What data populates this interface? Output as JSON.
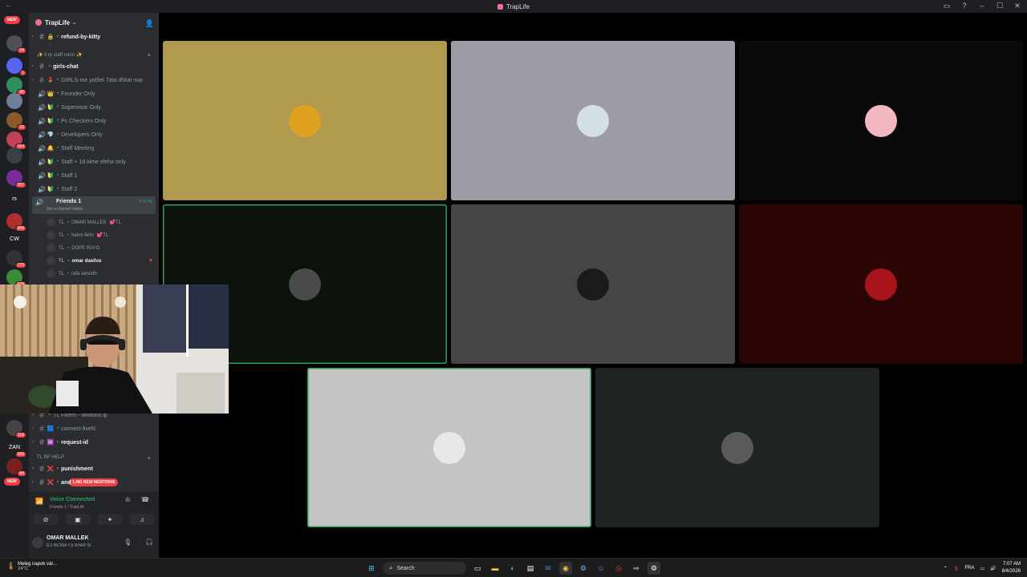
{
  "window": {
    "title": "TrapLife"
  },
  "servers": [
    {
      "label": "NEW",
      "badge": "",
      "color": "#f23f43"
    },
    {
      "label": "",
      "badge": "24",
      "color": "#4e5058"
    },
    {
      "label": "",
      "badge": "1",
      "color": "#5865f2"
    },
    {
      "label": "",
      "badge": "96",
      "color": "#2f8f5b"
    },
    {
      "label": "",
      "badge": "",
      "color": "#6d7f99"
    },
    {
      "label": "",
      "badge": "22",
      "color": "#8a5a2b"
    },
    {
      "label": "",
      "badge": "164",
      "color": "#c2405a"
    },
    {
      "label": "",
      "badge": "",
      "color": "#3b3f45"
    },
    {
      "label": "",
      "badge": "287",
      "color": "#7a2b9a"
    },
    {
      "label": "rs",
      "badge": "",
      "color": "#1e1f22"
    },
    {
      "label": "",
      "badge": "306",
      "color": "#b0302f"
    },
    {
      "label": "CW",
      "badge": "",
      "color": "#1e1f22"
    },
    {
      "label": "",
      "badge": "179",
      "color": "#333"
    },
    {
      "label": "",
      "badge": "678",
      "color": "#3a8a3a"
    }
  ],
  "servers_lower": [
    {
      "label": "",
      "badge": "116",
      "color": "#444"
    },
    {
      "label": "ZAN",
      "badge": "306",
      "color": "#222"
    },
    {
      "label": "",
      "badge": "84",
      "color": "#7a1f1f"
    },
    {
      "label": "NEW",
      "badge": "",
      "color": "#f23f43"
    }
  ],
  "server": {
    "name": "TrapLife"
  },
  "channels_top": [
    {
      "type": "text",
      "emoji": "🔒",
      "name": "refund-by-kitty",
      "bold": true
    }
  ],
  "category_staff": "✨ tl rp staff room ✨",
  "channels_staff": [
    {
      "type": "text",
      "emoji": "",
      "name": "girls-chat",
      "bold": true
    },
    {
      "type": "text",
      "emoji": "💄",
      "name": "GIRLS-me yot5el 7ata dhkar-svp",
      "bold": false
    },
    {
      "type": "voice",
      "emoji": "👑",
      "name": "Founder Only",
      "bold": false
    },
    {
      "type": "voice",
      "emoji": "🔰",
      "name": "Supervisor Only",
      "bold": false
    },
    {
      "type": "voice",
      "emoji": "🔰",
      "name": "Pc Checkers Only",
      "bold": false
    },
    {
      "type": "voice",
      "emoji": "💎",
      "name": "Developers Only",
      "bold": false
    },
    {
      "type": "voice",
      "emoji": "🔔",
      "name": "Staff Meeting",
      "bold": false
    },
    {
      "type": "voice",
      "emoji": "🔰",
      "name": "Staff + 18 klme sfeha only",
      "bold": false
    },
    {
      "type": "voice",
      "emoji": "🔰",
      "name": "Staff 1",
      "bold": false
    },
    {
      "type": "voice",
      "emoji": "🔰",
      "name": "Staff 2",
      "bold": false
    }
  ],
  "active_voice": {
    "name": "Friends 1",
    "status": "Set a channel status",
    "time": "5:16:48"
  },
  "voice_users": [
    {
      "tag": "TL",
      "name": "OMAR MALLEK",
      "extra": "💕TL",
      "highlight": false
    },
    {
      "tag": "TL",
      "name": "helmi ferhi",
      "extra": "💕TL",
      "highlight": false
    },
    {
      "tag": "TL",
      "name": "DOPE RAYO",
      "extra": "",
      "highlight": false
    },
    {
      "tag": "TL",
      "name": "omar dasilva",
      "extra": "",
      "highlight": true
    },
    {
      "tag": "TL",
      "name": "rafa lamridh",
      "extra": "",
      "highlight": false
    }
  ],
  "channels_lower": [
    {
      "type": "text",
      "emoji": "",
      "name": "TL Fivem - whitelist ip",
      "bold": false
    },
    {
      "type": "text",
      "emoji": "🟦",
      "name": "connect-fiveN",
      "bold": false
    },
    {
      "type": "text",
      "emoji": "🆔",
      "name": "request-id",
      "bold": true
    }
  ],
  "category_help": "TL RP HELP",
  "channels_help": [
    {
      "type": "text",
      "emoji": "❌",
      "name": "punishment",
      "bold": true
    },
    {
      "type": "text",
      "emoji": "❌",
      "name": "and",
      "bold": true
    }
  ],
  "mentions": "1,481 NEW MENTIONS",
  "voice_panel": {
    "label": "Voice Connected",
    "sub": "Friends 1 / TrapLife"
  },
  "user": {
    "name": "OMAR MALLEK",
    "sub": "ELI BE3NA YJI NHAR W..."
  },
  "tiles": [
    {
      "bg": "#b09a4d",
      "avatar": "#e0a020",
      "speaking": false
    },
    {
      "bg": "#9d9ba6",
      "avatar": "#d5dfe6",
      "speaking": false
    },
    {
      "bg": "#0a0a0a",
      "avatar": "#f2b8c2",
      "speaking": false
    },
    {
      "bg": "#0b120b",
      "avatar": "#4a4a4a",
      "speaking": true
    },
    {
      "bg": "#454545",
      "avatar": "#1a1a1a",
      "speaking": false
    },
    {
      "bg": "#2b0506",
      "avatar": "#a8141a",
      "speaking": false
    },
    {
      "bg": "#c4c4c4",
      "avatar": "#e8e8e8",
      "speaking": true
    },
    {
      "bg": "#1f2321",
      "avatar": "#5a5a5a",
      "speaking": false
    }
  ],
  "taskbar": {
    "weather_title": "Meleg napok vár...",
    "weather_temp": "24°C",
    "search": "Search",
    "lang": "FRA",
    "time": "7:07 AM",
    "date": "8/4/2026"
  }
}
